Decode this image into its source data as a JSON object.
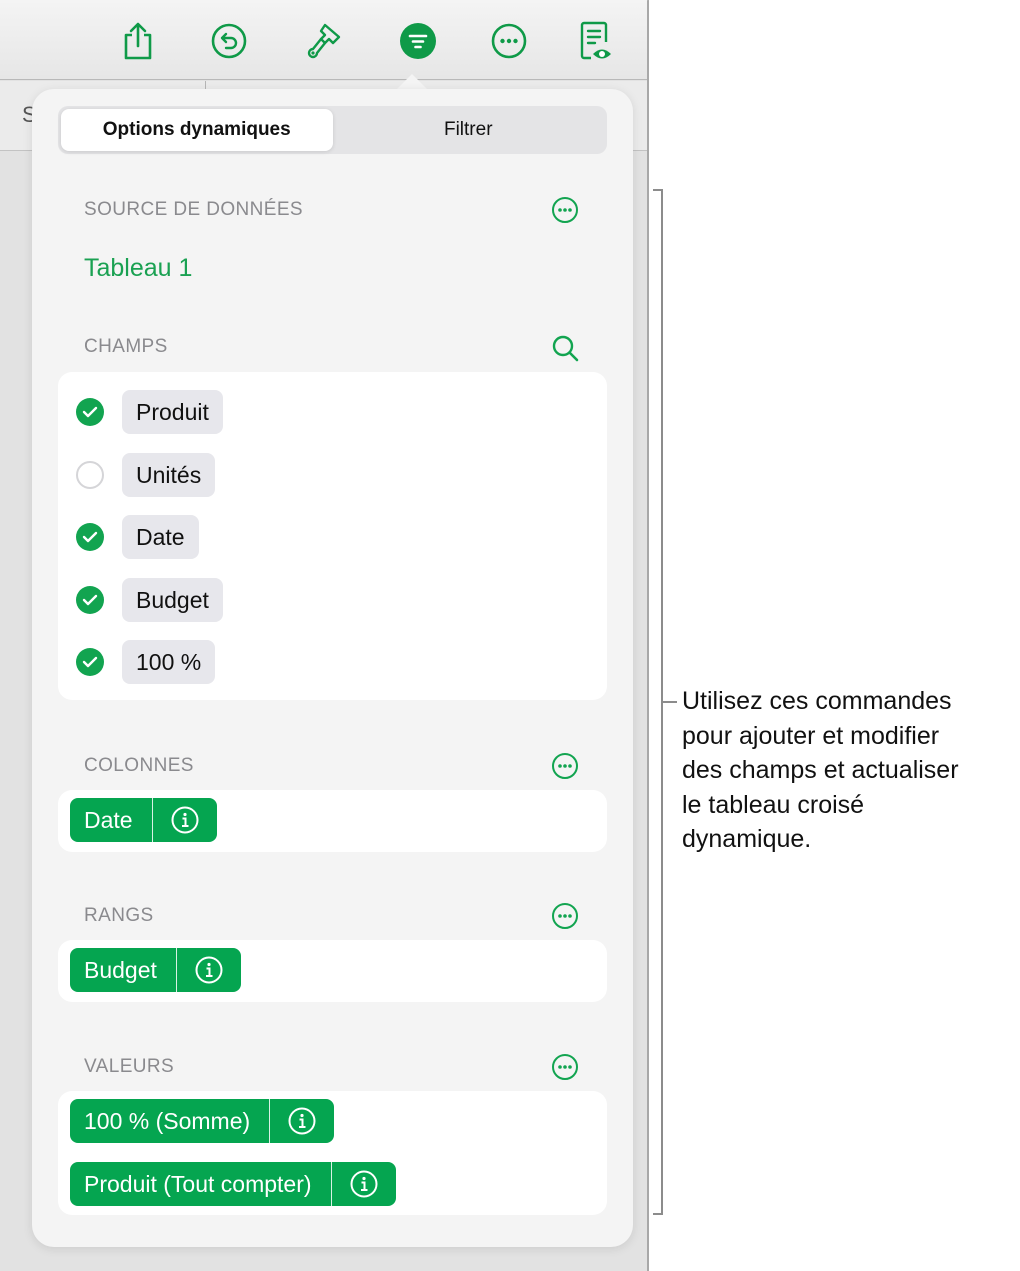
{
  "toolbar": {
    "icons": [
      {
        "name": "share-icon"
      },
      {
        "name": "undo-icon"
      },
      {
        "name": "format-brush-icon"
      },
      {
        "name": "organize-filter-icon",
        "active": true
      },
      {
        "name": "more-icon"
      },
      {
        "name": "reading-view-icon"
      }
    ]
  },
  "subbar": {
    "partial_letter": "S"
  },
  "popover": {
    "tabs": [
      {
        "label": "Options dynamiques",
        "active": true
      },
      {
        "label": "Filtrer",
        "active": false
      }
    ],
    "data_source": {
      "label": "SOURCE DE DONNÉES",
      "value": "Tableau 1",
      "action_icon": "more-circle-icon"
    },
    "fields": {
      "label": "CHAMPS",
      "action_icon": "search-icon",
      "items": [
        {
          "label": "Produit",
          "checked": true
        },
        {
          "label": "Unités",
          "checked": false
        },
        {
          "label": "Date",
          "checked": true
        },
        {
          "label": "Budget",
          "checked": true
        },
        {
          "label": "100 %",
          "checked": true
        }
      ]
    },
    "columns": {
      "label": "COLONNES",
      "action_icon": "more-circle-icon",
      "tokens": [
        {
          "label": "Date"
        }
      ]
    },
    "rows": {
      "label": "RANGS",
      "action_icon": "more-circle-icon",
      "tokens": [
        {
          "label": "Budget"
        }
      ]
    },
    "values": {
      "label": "VALEURS",
      "action_icon": "more-circle-icon",
      "tokens": [
        {
          "label": "100 % (Somme)"
        },
        {
          "label": "Produit (Tout compter)"
        }
      ]
    }
  },
  "annotation": {
    "text": "Utilisez ces commandes\npour ajouter et modifier\ndes champs et actualiser\nle tableau croisé\ndynamique."
  },
  "colors": {
    "accent": "#12a450",
    "token_bg": "#05a550",
    "section_label": "#8a8a8e",
    "popover_bg": "#f4f4f4"
  }
}
